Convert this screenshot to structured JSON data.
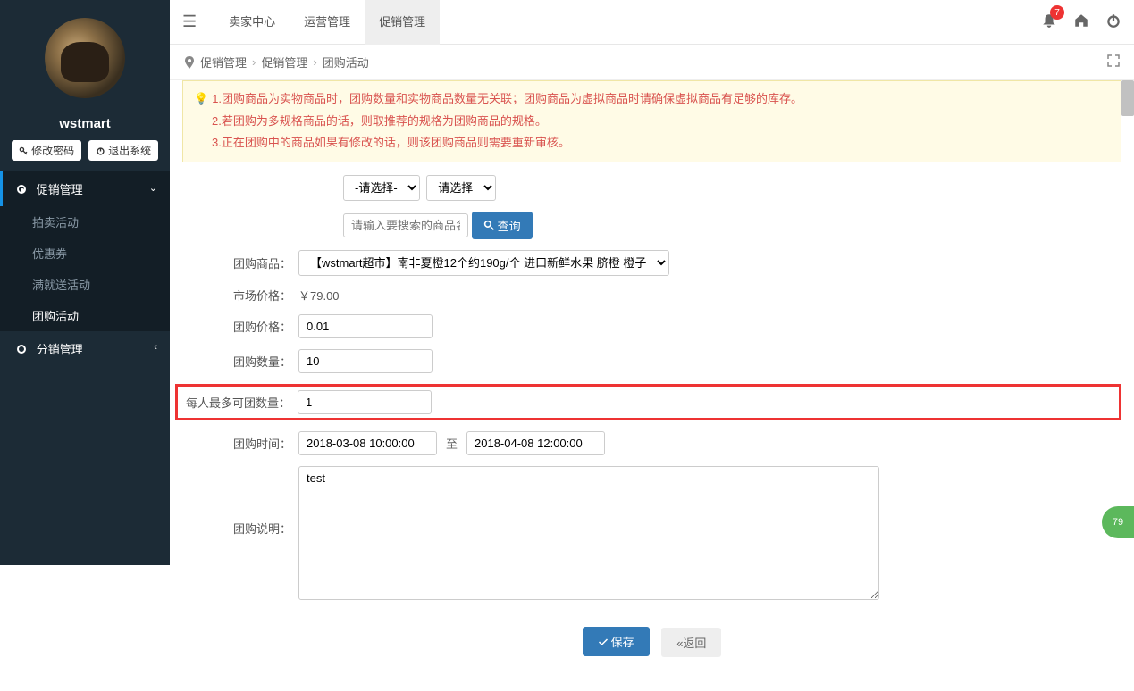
{
  "sidebar": {
    "username": "wstmart",
    "btn_password": "修改密码",
    "btn_logout": "退出系统",
    "groups": [
      {
        "label": "促销管理",
        "active": true,
        "expanded": true,
        "items": [
          {
            "label": "拍卖活动",
            "current": false
          },
          {
            "label": "优惠券",
            "current": false
          },
          {
            "label": "满就送活动",
            "current": false
          },
          {
            "label": "团购活动",
            "current": true
          }
        ]
      },
      {
        "label": "分销管理",
        "active": false,
        "expanded": false,
        "items": []
      }
    ]
  },
  "topbar": {
    "items": [
      "卖家中心",
      "运营管理",
      "促销管理"
    ],
    "active_index": 2,
    "badge_count": "7"
  },
  "breadcrumb": {
    "icon": "map-marker",
    "items": [
      "促销管理",
      "促销管理",
      "团购活动"
    ]
  },
  "tips": [
    "1.团购商品为实物商品时，团购数量和实物商品数量无关联；团购商品为虚拟商品时请确保虚拟商品有足够的库存。",
    "2.若团购为多规格商品的话，则取推荐的规格为团购商品的规格。",
    "3.正在团购中的商品如果有修改的话，则该团购商品则需要重新审核。"
  ],
  "form": {
    "select1_placeholder": "-请选择-",
    "select2_placeholder": "请选择",
    "search_placeholder": "请输入要搜索的商品名称",
    "search_btn": "查询",
    "goods_label": "团购商品：",
    "goods_value": "【wstmart超市】南非夏橙12个约190g/个 进口新鲜水果 脐橙 橙子",
    "market_label": "市场价格：",
    "market_value": "￥79.00",
    "price_label": "团购价格：",
    "price_value": "0.01",
    "qty_label": "团购数量：",
    "qty_value": "10",
    "maxper_label": "每人最多可团数量：",
    "maxper_value": "1",
    "time_label": "团购时间：",
    "time_start": "2018-03-08 10:00:00",
    "time_sep": "至",
    "time_end": "2018-04-08 12:00:00",
    "desc_label": "团购说明：",
    "desc_value": "test",
    "save_btn": "保存",
    "back_btn": "«返回"
  },
  "fab_label": "79"
}
